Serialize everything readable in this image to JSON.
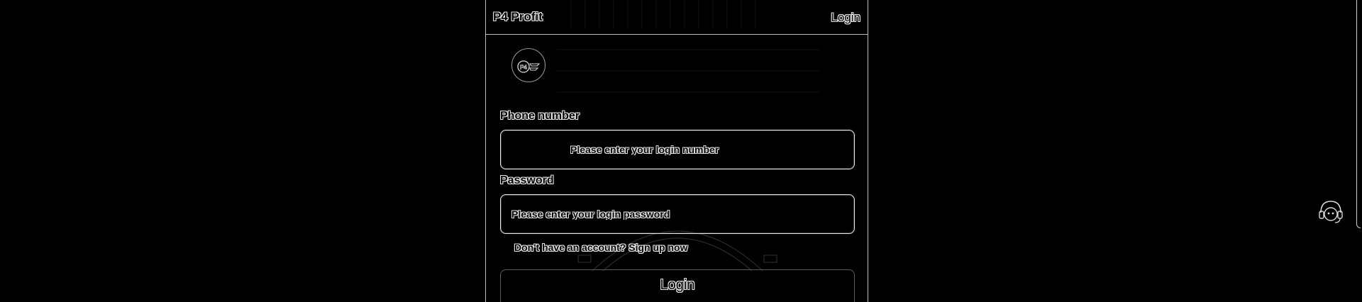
{
  "header": {
    "title": "P4 Profit",
    "login_label": "Login"
  },
  "logo": {
    "icon": "brand-logo-icon",
    "text": "P4"
  },
  "form": {
    "phone": {
      "label": "Phone number",
      "placeholder": "Please enter your login number",
      "value": ""
    },
    "password": {
      "label": "Password",
      "placeholder": "Please enter your login password",
      "value": ""
    },
    "signup_prompt": "Don't have an account?",
    "signup_link": "Sign up now",
    "submit_label": "Login"
  },
  "support": {
    "icon": "customer-service-icon"
  },
  "colors": {
    "background": "#000000",
    "outline": "#e6e6e6",
    "border": "#bdbdbd"
  }
}
